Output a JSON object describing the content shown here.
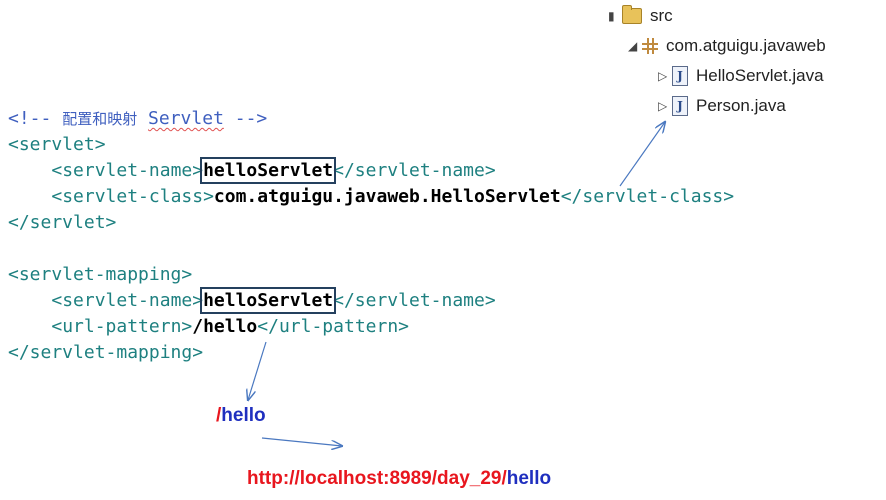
{
  "tree": {
    "src": "src",
    "package": "com.atguigu.javaweb",
    "files": [
      "HelloServlet.java",
      "Person.java"
    ],
    "java_icon_letter": "J"
  },
  "code": {
    "comment_open": "<!-- ",
    "comment_cn": "配置和映射",
    "comment_servlet": "Servlet",
    "comment_close": " -->",
    "servlet_open": "<servlet>",
    "servlet_name_open": "<servlet-name>",
    "servlet_name_value": "helloServlet",
    "servlet_name_close": "</servlet-name>",
    "servlet_class_open": "<servlet-class>",
    "servlet_class_value": "com.atguigu.javaweb.HelloServlet",
    "servlet_class_close": "</servlet-class>",
    "servlet_close": "</servlet>",
    "mapping_open": "<servlet-mapping>",
    "mapping_name_open": "<servlet-name>",
    "mapping_name_value": "helloServlet",
    "mapping_name_close": "</servlet-name>",
    "url_open": "<url-pattern>",
    "url_value": "/hello",
    "url_close": "</url-pattern>",
    "mapping_close": "</servlet-mapping>"
  },
  "pattern_label": {
    "slash": "/",
    "word": "hello"
  },
  "url": {
    "prefix": "http://localhost:8989/day_29/",
    "suffix": "hello"
  },
  "colors": {
    "tag": "#1e8080",
    "comment": "#3f5fbf",
    "box": "#24405e",
    "arrow": "#4a78c0",
    "red": "#e8161e",
    "blue": "#1f2fbf"
  }
}
